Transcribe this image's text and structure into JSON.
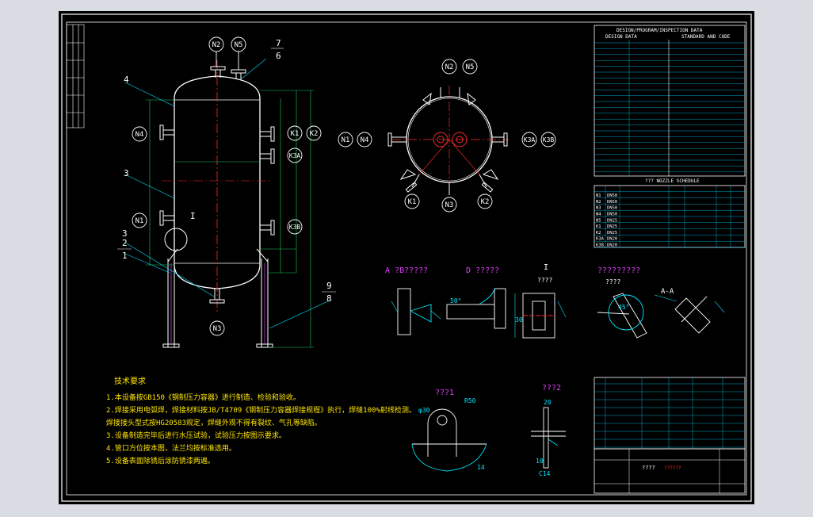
{
  "colors": {
    "background": "#000000",
    "frame": "#ffffff",
    "outline": "#ffffff",
    "centerline": "#ff2a2a",
    "dimension": "#22c55e",
    "annotation": "#00e5ff",
    "title_magenta": "#e040fb",
    "nozzle_label": "#ffffff",
    "yellow": "#ffe600",
    "table_line": "#00d0ff"
  },
  "nozzles": {
    "n2": "N2",
    "n5": "N5",
    "n4": "N4",
    "n1": "N1",
    "n3": "N3",
    "k1": "K1",
    "k2": "K2",
    "k3a": "K3A",
    "k3b": "K3B"
  },
  "parts": {
    "p7": "7",
    "p6": "6",
    "p4": "4",
    "p3": "3",
    "p3b": "3",
    "p2": "2",
    "p1": "1",
    "p9": "9",
    "p8": "8",
    "detail_i": "I"
  },
  "detail_views": {
    "a_view": "A ?B?????",
    "d_view": "D ?????",
    "i_view_num": "I",
    "i_view_sub": "????",
    "weld_title": "?????????",
    "weld_sub": "????",
    "section": "A-A",
    "detail1": "???1",
    "detail2": "???2"
  },
  "tech_req": {
    "title": "技术要求",
    "lines": [
      "1.本设备按GB150《钢制压力容器》进行制造、检验和验收。",
      "2.焊接采用电弧焊，焊接材料按JB/T4709《钢制压力容器焊接规程》执行，焊缝100%射线检测。",
      "  焊接接头型式按HG20583规定，焊缝外观不得有裂纹、气孔等缺陷。",
      "3.设备制造完毕后进行水压试验，试验压力按图示要求。",
      "4.管口方位按本图，法兰均按标准选用。",
      "5.设备表面除锈后涂防锈漆两遍。"
    ]
  },
  "design_data": {
    "title": "DESIGN/PROGRAM/INSPECTION DATA",
    "sub_left": "DESIGN DATA",
    "sub_right": "STANDARD AND CODE"
  },
  "nozzle_schedule": {
    "title": "??? NOZZLE SCHEDULE",
    "rows": [
      [
        "N1",
        "DN50"
      ],
      [
        "N2",
        "DN50"
      ],
      [
        "N3",
        "DN50"
      ],
      [
        "N4",
        "DN50"
      ],
      [
        "N5",
        "DN25"
      ],
      [
        "K1",
        "DN25"
      ],
      [
        "K2",
        "DN25"
      ],
      [
        "K3A",
        "DN20"
      ],
      [
        "K3B",
        "DN20"
      ]
    ]
  },
  "title_block": {
    "drawing_name": "????",
    "stamp": "??????"
  },
  "dims": {
    "phi30": "φ30",
    "r50": "R50",
    "d20": "20",
    "d14": "14",
    "c14": "C14",
    "d10": "10",
    "d50": "50°",
    "d45": "45°",
    "d30": "30"
  }
}
